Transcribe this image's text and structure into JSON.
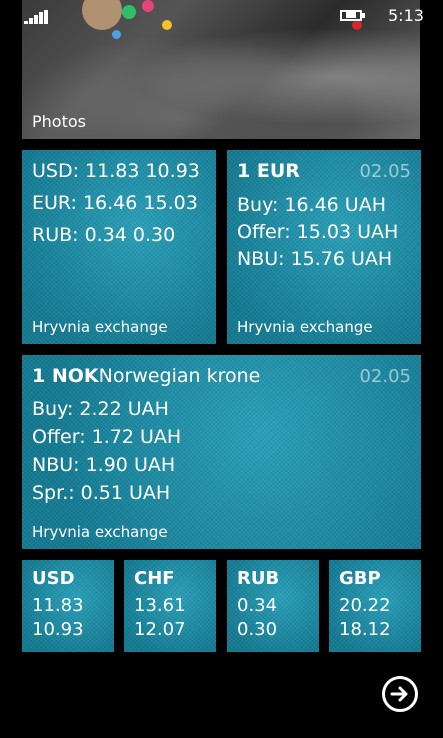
{
  "status": {
    "time": "5:13"
  },
  "photos": {
    "label": "Photos"
  },
  "tile_summary": {
    "rows": [
      "USD: 11.83 10.93",
      "EUR: 16.46 15.03",
      "RUB: 0.34 0.30"
    ],
    "footer": "Hryvnia exchange"
  },
  "tile_eur": {
    "code": "1 EUR",
    "date": "02.05",
    "buy": "Buy: 16.46 UAH",
    "offer": "Offer: 15.03 UAH",
    "nbu": "NBU: 15.76 UAH",
    "footer": "Hryvnia exchange"
  },
  "tile_nok": {
    "code": "1 NOK",
    "name": "Norwegian krone",
    "date": "02.05",
    "buy": "Buy: 2.22 UAH",
    "offer": "Offer: 1.72 UAH",
    "nbu": "NBU: 1.90 UAH",
    "spr": "Spr.: 0.51 UAH",
    "footer": "Hryvnia exchange"
  },
  "mini_tiles": [
    {
      "code": "USD",
      "buy": "11.83",
      "offer": "10.93"
    },
    {
      "code": "CHF",
      "buy": "13.61",
      "offer": "12.07"
    },
    {
      "code": "RUB",
      "buy": "0.34",
      "offer": "0.30"
    },
    {
      "code": "GBP",
      "buy": "20.22",
      "offer": "18.12"
    }
  ],
  "colors": {
    "tile": "#1a8aa3",
    "background": "#000000"
  },
  "icons": {
    "next": "arrow-right-circle-icon"
  }
}
